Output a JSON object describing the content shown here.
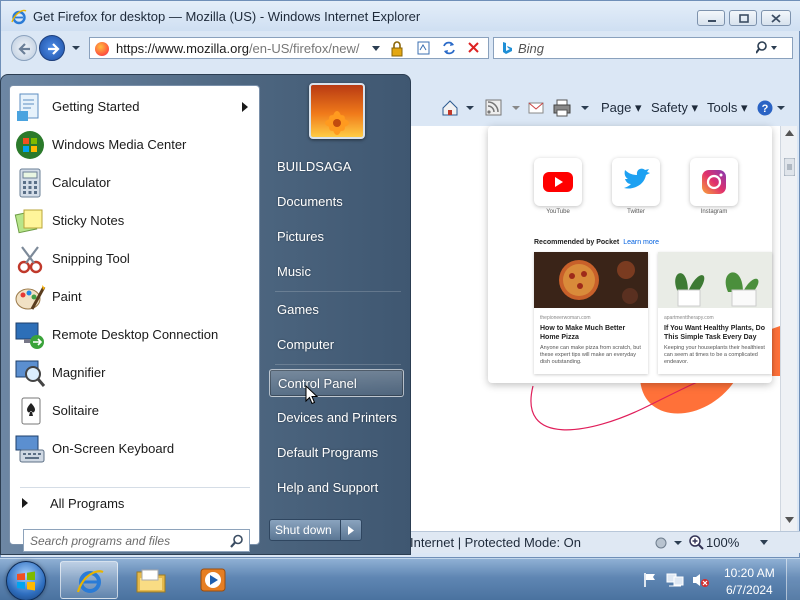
{
  "browser": {
    "window_title": "Get Firefox for desktop — Mozilla (US) - Windows Internet Explorer",
    "address": {
      "scheme": "https://www.",
      "domain": "mozilla.org",
      "path": "/en-US/firefox/new/"
    },
    "search_placeholder": "Bing",
    "command_bar": {
      "page": "Page",
      "safety": "Safety",
      "tools": "Tools"
    },
    "status_text": "Internet | Protected Mode: On",
    "zoom": "100%"
  },
  "firefox_page": {
    "tiles": [
      "YouTube",
      "Twitter",
      "Instagram"
    ],
    "pocket_heading": "Recommended by Pocket",
    "pocket_link": "Learn more",
    "stories": [
      {
        "source": "thepioneerwoman.com",
        "title": "How to Make Much Better Home Pizza",
        "excerpt": "Anyone can make pizza from scratch, but these expert tips will make an everyday dish outstanding."
      },
      {
        "source": "apartmenttherapy.com",
        "title": "If You Want Healthy Plants, Do This Simple Task Every Day",
        "excerpt": "Keeping your houseplants their healthiest can seem at times to be a complicated endeavor."
      }
    ]
  },
  "start_menu": {
    "programs": [
      {
        "label": "Getting Started",
        "icon": "getting-started-icon",
        "has_submenu": true
      },
      {
        "label": "Windows Media Center",
        "icon": "media-center-icon"
      },
      {
        "label": "Calculator",
        "icon": "calculator-icon"
      },
      {
        "label": "Sticky Notes",
        "icon": "sticky-notes-icon"
      },
      {
        "label": "Snipping Tool",
        "icon": "snipping-tool-icon"
      },
      {
        "label": "Paint",
        "icon": "paint-icon"
      },
      {
        "label": "Remote Desktop Connection",
        "icon": "remote-desktop-icon"
      },
      {
        "label": "Magnifier",
        "icon": "magnifier-icon"
      },
      {
        "label": "Solitaire",
        "icon": "solitaire-icon"
      },
      {
        "label": "On-Screen Keyboard",
        "icon": "keyboard-icon"
      }
    ],
    "all_programs": "All Programs",
    "search_placeholder": "Search programs and files",
    "right_items": [
      {
        "label": "BUILDSAGA"
      },
      {
        "label": "Documents"
      },
      {
        "label": "Pictures"
      },
      {
        "label": "Music"
      },
      {
        "label": "Games"
      },
      {
        "label": "Computer"
      },
      {
        "label": "Control Panel",
        "hovered": true
      },
      {
        "label": "Devices and Printers"
      },
      {
        "label": "Default Programs"
      },
      {
        "label": "Help and Support"
      }
    ],
    "shutdown_label": "Shut down"
  },
  "taskbar": {
    "pinned": [
      "internet-explorer-icon",
      "windows-explorer-icon",
      "media-player-icon"
    ],
    "active": "internet-explorer-icon",
    "tray_icons": [
      "action-center-flag-icon",
      "network-icon",
      "volume-muted-icon"
    ],
    "time": "10:20 AM",
    "date": "6/7/2024"
  },
  "colors": {
    "start_menu_right": "#4d6680",
    "taskbar": "#5f86b3",
    "firefox_orange": "#ff7139",
    "accent_blue": "#1d4fa5"
  }
}
